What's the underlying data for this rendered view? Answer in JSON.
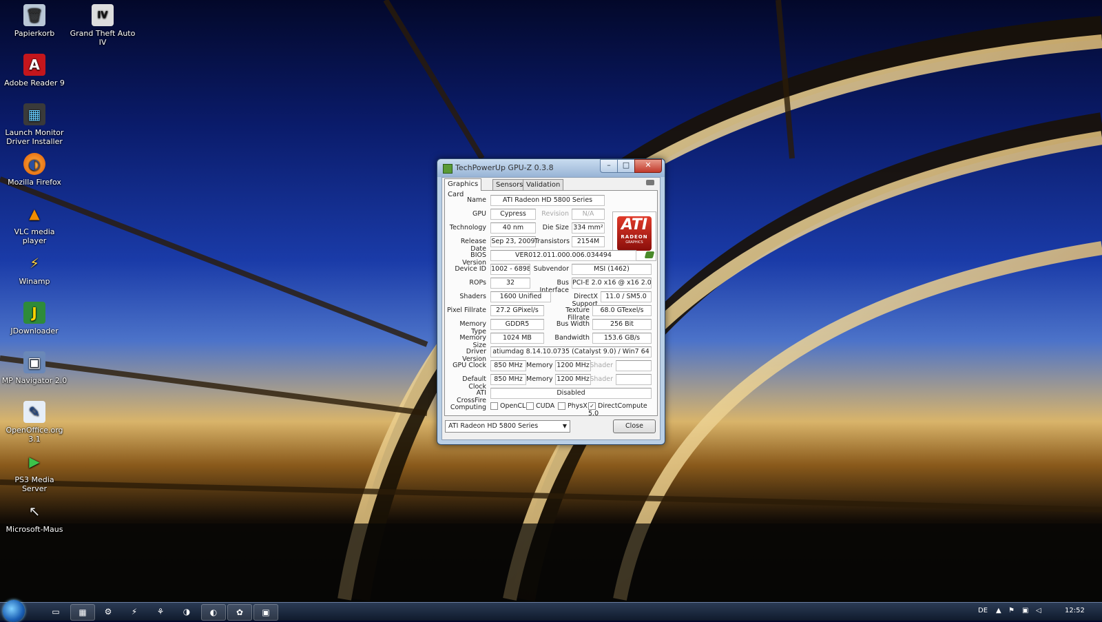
{
  "desktop_icons": [
    {
      "label": "Papierkorb",
      "icon": "recycle-bin-icon",
      "glyph": "🗑"
    },
    {
      "label": "Grand Theft Auto IV",
      "icon": "gta-iv-icon",
      "glyph": "IV"
    },
    {
      "label": "Adobe Reader 9",
      "icon": "adobe-reader-icon",
      "glyph": "A"
    },
    {
      "label": "Launch Monitor Driver Installer",
      "icon": "monitor-driver-icon",
      "glyph": "▦"
    },
    {
      "label": "Mozilla Firefox",
      "icon": "firefox-icon",
      "glyph": "◐"
    },
    {
      "label": "VLC media player",
      "icon": "vlc-icon",
      "glyph": "▲"
    },
    {
      "label": "Winamp",
      "icon": "winamp-icon",
      "glyph": "⚡"
    },
    {
      "label": "JDownloader",
      "icon": "jdownloader-icon",
      "glyph": "J"
    },
    {
      "label": "MP Navigator 2.0",
      "icon": "mp-navigator-icon",
      "glyph": "▣"
    },
    {
      "label": "OpenOffice.org 3.1",
      "icon": "openoffice-icon",
      "glyph": "✎"
    },
    {
      "label": "PS3 Media Server",
      "icon": "ps3-media-server-icon",
      "glyph": "▶"
    },
    {
      "label": "Microsoft-Maus",
      "icon": "mouse-icon",
      "glyph": "↖"
    }
  ],
  "window": {
    "title": "TechPowerUp GPU-Z 0.3.8",
    "tabs": [
      "Graphics Card",
      "Sensors",
      "Validation"
    ],
    "active_tab": "Graphics Card",
    "logo": {
      "brand": "ATI",
      "line1": "RADEON",
      "line2": "GRAPHICS"
    },
    "fields": {
      "name_label": "Name",
      "name": "ATI Radeon HD 5800 Series",
      "gpu_label": "GPU",
      "gpu": "Cypress",
      "revision_label": "Revision",
      "revision": "N/A",
      "technology_label": "Technology",
      "technology": "40 nm",
      "die_size_label": "Die Size",
      "die_size": "334 mm²",
      "release_date_label": "Release Date",
      "release_date": "Sep 23, 2009",
      "transistors_label": "Transistors",
      "transistors": "2154M",
      "bios_label": "BIOS Version",
      "bios": "VER012.011.000.006.034494",
      "device_id_label": "Device ID",
      "device_id": "1002 - 6898",
      "subvendor_label": "Subvendor",
      "subvendor": "MSI (1462)",
      "rops_label": "ROPs",
      "rops": "32",
      "bus_interface_label": "Bus Interface",
      "bus_interface": "PCI-E 2.0 x16 @ x16 2.0",
      "shaders_label": "Shaders",
      "shaders": "1600 Unified",
      "directx_label": "DirectX Support",
      "directx": "11.0 / SM5.0",
      "pixel_fillrate_label": "Pixel Fillrate",
      "pixel_fillrate": "27.2 GPixel/s",
      "texture_fillrate_label": "Texture Fillrate",
      "texture_fillrate": "68.0 GTexel/s",
      "memory_type_label": "Memory Type",
      "memory_type": "GDDR5",
      "bus_width_label": "Bus Width",
      "bus_width": "256 Bit",
      "memory_size_label": "Memory Size",
      "memory_size": "1024 MB",
      "bandwidth_label": "Bandwidth",
      "bandwidth": "153.6 GB/s",
      "driver_version_label": "Driver Version",
      "driver_version": "atiumdag 8.14.10.0735 (Catalyst 9.0) / Win7 64",
      "gpu_clock_label": "GPU Clock",
      "gpu_clock": "850 MHz",
      "memory_label": "Memory",
      "gpu_memory_clock": "1200 MHz",
      "shader_label": "Shader",
      "gpu_shader_clock": "",
      "default_clock_label": "Default Clock",
      "default_clock": "850 MHz",
      "default_memory_clock": "1200 MHz",
      "default_shader_clock": "",
      "crossfire_label": "ATI CrossFire",
      "crossfire": "Disabled",
      "computing_label": "Computing"
    },
    "computing": [
      {
        "label": "OpenCL",
        "checked": false
      },
      {
        "label": "CUDA",
        "checked": false
      },
      {
        "label": "PhysX",
        "checked": false
      },
      {
        "label": "DirectCompute 5.0",
        "checked": true
      }
    ],
    "card_select": "ATI Radeon HD 5800 Series",
    "close_button": "Close"
  },
  "taskbar": {
    "language": "DE",
    "clock": "12:52"
  }
}
